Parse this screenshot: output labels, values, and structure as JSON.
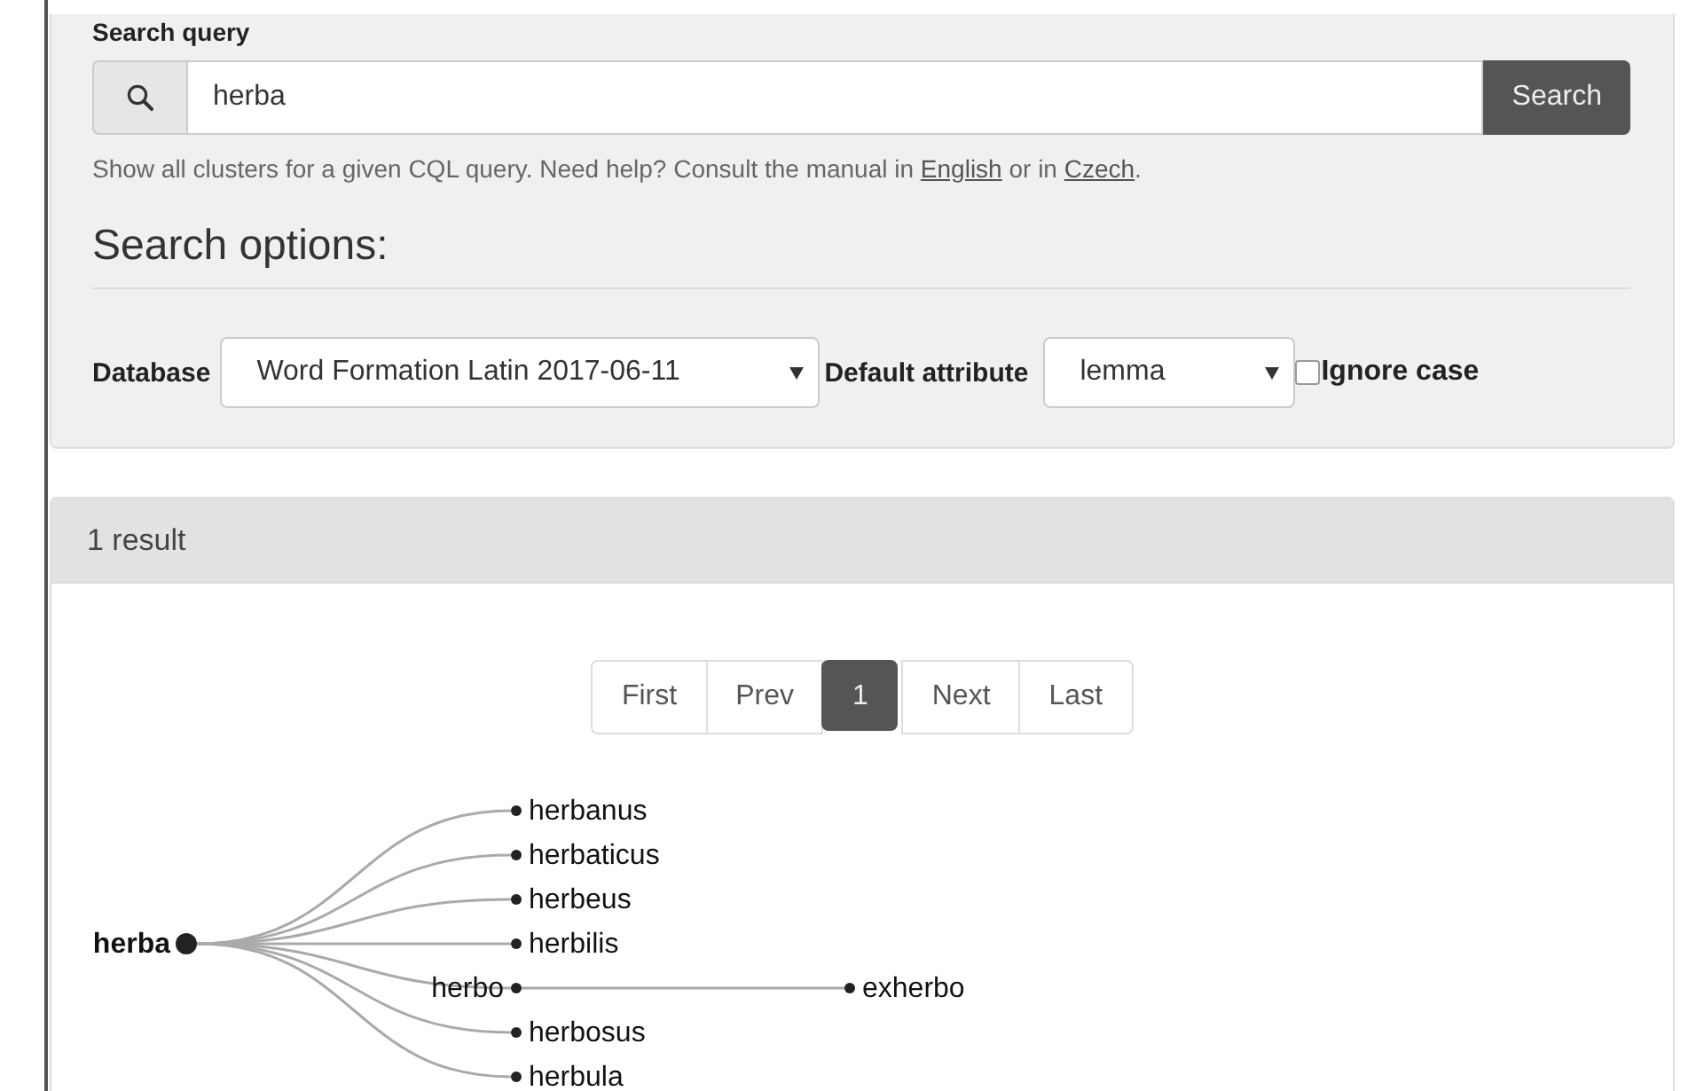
{
  "search": {
    "label": "Search query",
    "value": "herba",
    "button": "Search"
  },
  "help": {
    "before": "Show all clusters for a given CQL query. Need help? Consult the manual in ",
    "links": [
      "English",
      "Czech"
    ],
    "between": " or in ",
    "after": "."
  },
  "options": {
    "heading": "Search options:",
    "database_label": "Database",
    "database_value": "Word Formation Latin 2017-06-11",
    "attribute_label": "Default attribute",
    "attribute_value": "lemma",
    "ignore_case": {
      "label": "Ignore case",
      "checked": false
    }
  },
  "results": {
    "header": "1 result",
    "pagination": [
      {
        "label": "First",
        "selected": false
      },
      {
        "label": "Prev",
        "selected": false
      },
      {
        "label": "1",
        "selected": true
      },
      {
        "label": "Next",
        "selected": false
      },
      {
        "label": "Last",
        "selected": false
      }
    ],
    "tree": {
      "label": "herba",
      "children": [
        {
          "label": "herbanus"
        },
        {
          "label": "herbaticus"
        },
        {
          "label": "herbeus"
        },
        {
          "label": "herbilis"
        },
        {
          "label": "herbo",
          "children": [
            {
              "label": "exherbo"
            }
          ]
        },
        {
          "label": "herbosus"
        },
        {
          "label": "herbula"
        }
      ]
    }
  }
}
